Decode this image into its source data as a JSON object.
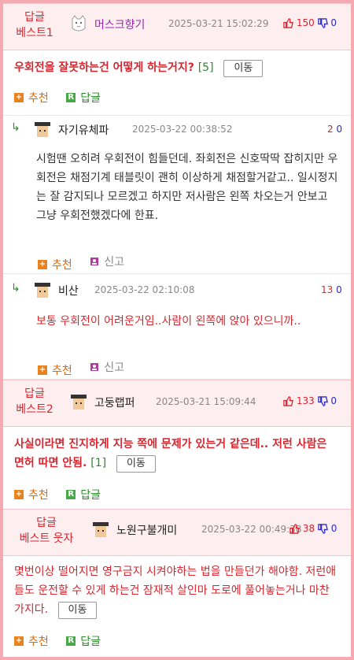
{
  "best1": {
    "label_line1": "답글",
    "label_line2": "베스트1",
    "nick": "머스크향기",
    "time": "2025-03-21 15:02:29",
    "up": "150",
    "down": "0",
    "text": "우회전을 잘못하는건 어떻게 하는거지?",
    "count": "[5]",
    "move_label": "이동",
    "recommend_label": "추천",
    "reply_label": "답글"
  },
  "reply1": {
    "nick": "자기유체파",
    "time": "2025-03-22 00:38:52",
    "up": "2",
    "down": "0",
    "text": "시험땐 오히려 우회전이 힘들던데. 좌회전은 신호딱딱 잡히지만 우회전은 채점기계 태블릿이 괜히 이상하게 채점할거같고.. 일시정지는 잘 감지되나 모르겠고 하지만 저사람은 왼쪽 차오는거 안보고 그냥 우회전했겠다에 한표.",
    "recommend_label": "추천",
    "report_label": "신고"
  },
  "reply2": {
    "nick": "비산",
    "time": "2025-03-22 02:10:08",
    "up": "13",
    "down": "0",
    "text": "보통 우회전이 어려운거임..사람이 왼쪽에 앉아 있으니까..",
    "recommend_label": "추천",
    "report_label": "신고"
  },
  "best2": {
    "label_line1": "답글",
    "label_line2": "베스트2",
    "nick": "고둥랩퍼",
    "time": "2025-03-21 15:09:44",
    "up": "133",
    "down": "0",
    "text": "사실이라면 진지하게 지능 쪽에 문제가 있는거 같은데.. 저런 사람은 면허 따면 안됨.",
    "count": "[1]",
    "move_label": "이동",
    "recommend_label": "추천",
    "reply_label": "답글"
  },
  "best3": {
    "label_line1": "답글",
    "label_line2": "베스트 웃자",
    "nick": "노원구불개미",
    "time": "2025-03-22 00:49:38",
    "up": "38",
    "down": "0",
    "text": "몇번이상 떨어지면 영구금지 시켜야하는 법을 만들던가 해야함. 저런애들도 운전할 수 있게 하는건 잠재적 살인마 도로에 풀어놓는거나 마찬가지다.",
    "move_label": "이동",
    "recommend_label": "추천",
    "reply_label": "답글"
  },
  "colors": {
    "border": "#f4aab0",
    "best_bg": "#fdeef0",
    "red": "#d7262f",
    "blue": "#2a2ad0",
    "orange": "#e8821e",
    "green": "#4aa84a",
    "purple": "#9b26b0"
  },
  "icons": [
    "thumbs-up-icon",
    "thumbs-down-icon",
    "plus-icon",
    "reply-r-icon",
    "report-icon",
    "reply-arrow-icon",
    "cat-avatar-icon",
    "grad-cap-avatar-icon"
  ]
}
